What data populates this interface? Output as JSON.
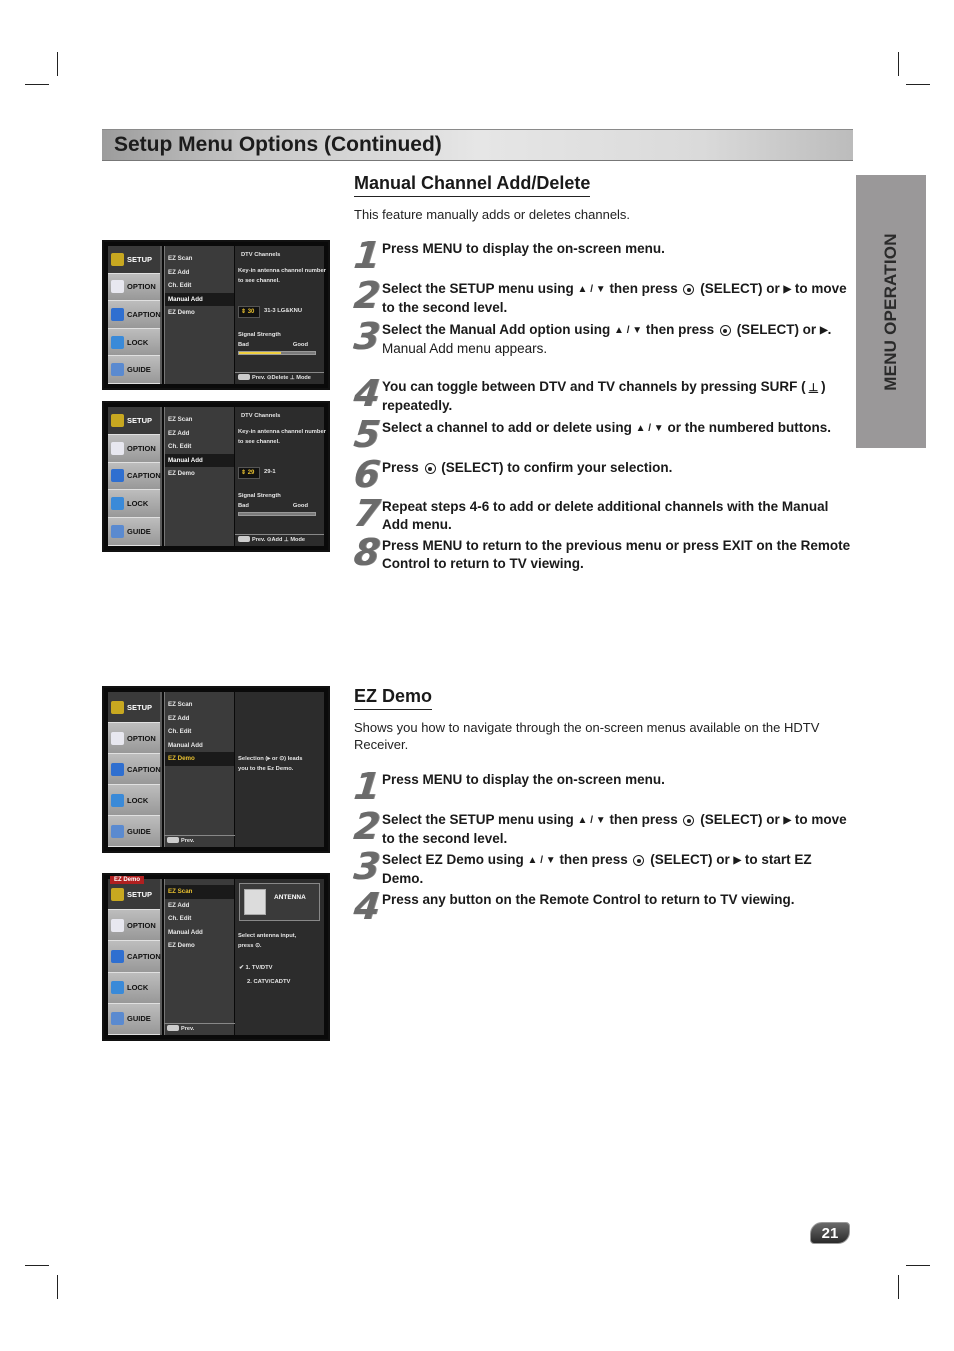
{
  "page": {
    "title": "Setup Menu Options (Continued)",
    "side_tab": "MENU OPERATION",
    "page_number": "21"
  },
  "manual_add": {
    "heading": "Manual Channel Add/Delete",
    "intro": "This feature manually adds or deletes channels.",
    "steps": [
      {
        "num": "1",
        "text": "Press MENU to display the on-screen menu."
      },
      {
        "num": "2",
        "pre": "Select the SETUP menu using ",
        "mid": " then press ",
        "post": " (SELECT) or ",
        "end": " to move to the second level."
      },
      {
        "num": "3",
        "pre": "Select the Manual Add option using ",
        "mid": " then press ",
        "post": " (SELECT) or ",
        "end": ".",
        "sub": "Manual Add menu appears."
      },
      {
        "num": "4",
        "pre": "You can toggle between DTV and TV channels by pressing SURF (",
        "end": ") repeatedly."
      },
      {
        "num": "5",
        "pre": "Select a channel to add or delete using ",
        "end": " or the numbered buttons."
      },
      {
        "num": "6",
        "pre": "Press ",
        "end": " (SELECT) to confirm your selection."
      },
      {
        "num": "7",
        "text": "Repeat steps 4-6 to add or delete additional channels with the Manual Add menu."
      },
      {
        "num": "8",
        "text": "Press MENU to return to the previous menu or press EXIT on the Remote Control to return to TV viewing."
      }
    ]
  },
  "ez_demo": {
    "heading": "EZ Demo",
    "intro": "Shows you how to navigate through the on-screen menus available on the HDTV Receiver.",
    "steps": [
      {
        "num": "1",
        "text": "Press MENU to display the on-screen menu."
      },
      {
        "num": "2",
        "pre": "Select the SETUP menu using ",
        "mid": " then press ",
        "post": " (SELECT) or ",
        "end": " to move to the second level."
      },
      {
        "num": "3",
        "pre": "Select EZ Demo using ",
        "mid": " then press ",
        "post": " (SELECT) or ",
        "end": " to start EZ Demo."
      },
      {
        "num": "4",
        "text": "Press any button on the Remote Control to return to TV viewing."
      }
    ]
  },
  "symbols": {
    "up_down": "▲ / ▼",
    "right": "▶",
    "surf": "⊥"
  },
  "tv": {
    "left_menu": [
      "SETUP",
      "OPTION",
      "CAPTION",
      "LOCK",
      "GUIDE"
    ],
    "left_menu_icon_colors": [
      "#c8a820",
      "#e8e8f0",
      "#2f6fd0",
      "#3a8ad8",
      "#5a8ad0"
    ],
    "mid_menu": [
      "EZ Scan",
      "EZ Add",
      "Ch. Edit",
      "Manual Add",
      "EZ Demo"
    ],
    "screen1": {
      "title": "DTV Channels",
      "desc": "Key-in antenna channel number to see channel.",
      "channel": "⇕ 30",
      "channel_name": "31-3 LG&KNU",
      "signal_label": "Signal Strength",
      "bad": "Bad",
      "good": "Good",
      "signal_level": 0.55,
      "footer": "Prev.  ⊙Delete  ⊥ Mode"
    },
    "screen2": {
      "title": "DTV Channels",
      "desc": "Key-in antenna channel number to see channel.",
      "channel": "⇕ 29",
      "channel_name": "29-1",
      "signal_label": "Signal Strength",
      "bad": "Bad",
      "good": "Good",
      "signal_level": 0.0,
      "footer": "Prev.   ⊙Add     ⊥ Mode"
    },
    "screen3": {
      "desc": "Selection (▸ or ⊙) leads you to the Ez Demo.",
      "footer": "Prev."
    },
    "screen4": {
      "badge": "EZ Demo",
      "antenna": "ANTENNA",
      "desc": "Select antenna input, press ⊙.",
      "opt1": "✔ 1. TV/DTV",
      "opt2": "2. CATV/CADTV",
      "footer": "Prev."
    }
  }
}
